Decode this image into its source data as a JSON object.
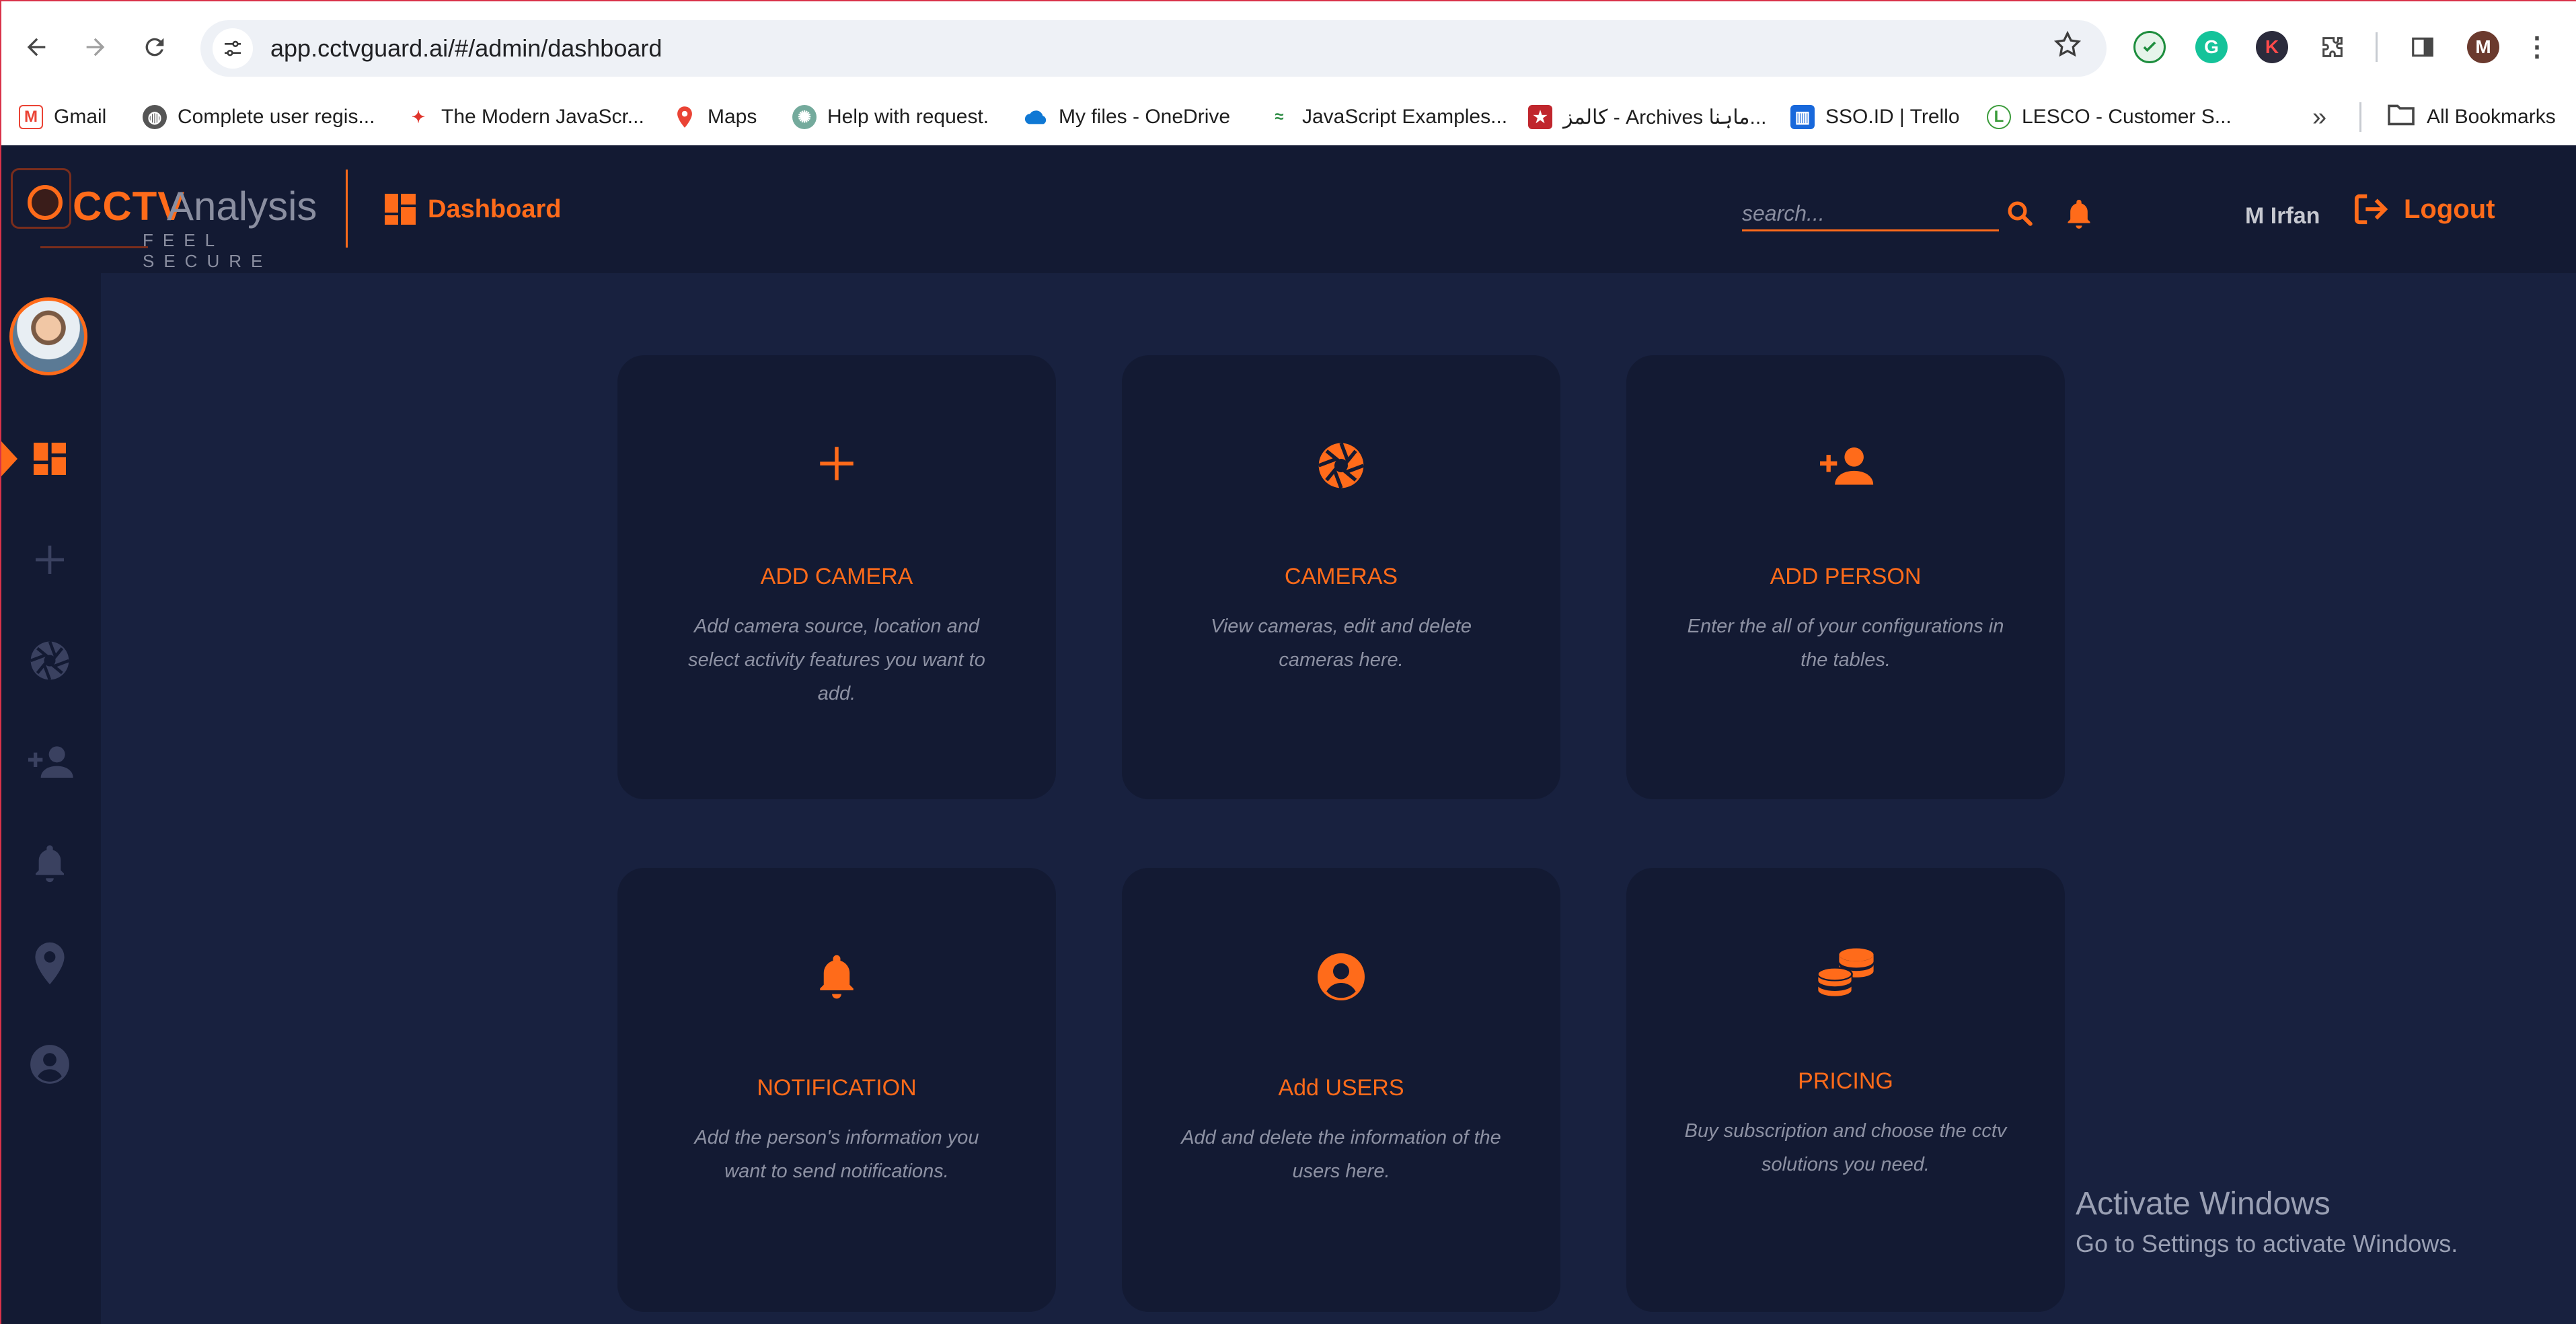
{
  "browser": {
    "url": "app.cctvguard.ai/#/admin/dashboard",
    "bookmarks": [
      {
        "label": "Gmail",
        "icon": "gmail-icon"
      },
      {
        "label": "Complete user regis...",
        "icon": "globe-icon"
      },
      {
        "label": "The Modern JavaScr...",
        "icon": "js-icon"
      },
      {
        "label": "Maps",
        "icon": "maps-icon"
      },
      {
        "label": "Help with request.",
        "icon": "chatgpt-icon"
      },
      {
        "label": "My files - OneDrive",
        "icon": "onedrive-icon"
      },
      {
        "label": "JavaScript Examples...",
        "icon": "gfg-icon"
      },
      {
        "label": "کالمز - Archives ماہنا...",
        "icon": "site-icon"
      },
      {
        "label": "SSO.ID | Trello",
        "icon": "trello-icon"
      },
      {
        "label": "LESCO - Customer S...",
        "icon": "lesco-icon"
      }
    ],
    "all_bookmarks": "All Bookmarks",
    "profile_initial": "M"
  },
  "header": {
    "logo_cctv": "CCTV",
    "logo_analysis": "Analysis",
    "logo_tagline": "FEEL SECURE",
    "page_title": "Dashboard",
    "search_placeholder": "search...",
    "user_name": "M Irfan",
    "logout_label": "Logout"
  },
  "cards": [
    {
      "icon": "plus-icon",
      "title": "ADD CAMERA",
      "desc": "Add camera source, location and select activity features you want to add."
    },
    {
      "icon": "aperture-icon",
      "title": "CAMERAS",
      "desc": "View cameras, edit and delete cameras here."
    },
    {
      "icon": "person-add-icon",
      "title": "ADD PERSON",
      "desc": "Enter the all of your configurations in the tables."
    },
    {
      "icon": "bell-icon",
      "title": "NOTIFICATION",
      "desc": "Add the person's information you want to send notifications."
    },
    {
      "icon": "account-circle-icon",
      "title": "Add USERS",
      "desc": "Add and delete the information of the users here."
    },
    {
      "icon": "coins-icon",
      "title": "PRICING",
      "desc": "Buy subscription and choose the cctv solutions you need."
    }
  ],
  "watermark": {
    "title": "Activate Windows",
    "subtitle": "Go to Settings to activate Windows."
  },
  "colors": {
    "accent": "#ff6b1a",
    "header_bg": "#131a33",
    "main_bg": "#18213f",
    "card_bg": "#131a33",
    "sidebar_icon_inactive": "#3a4160"
  }
}
